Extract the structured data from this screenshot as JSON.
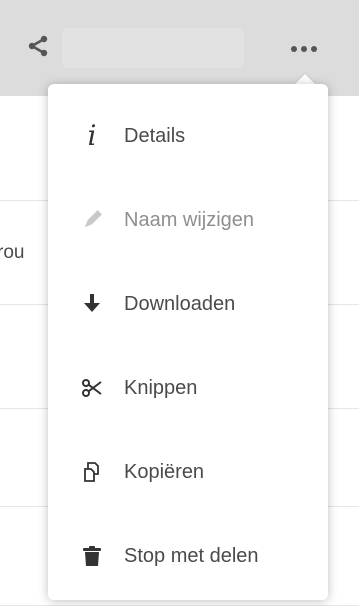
{
  "header": {
    "share_icon": "share-icon",
    "more_icon": "more-horizontal-icon"
  },
  "background": {
    "partial_text": "rou"
  },
  "menu": {
    "items": [
      {
        "label": "Details",
        "icon": "info-icon"
      },
      {
        "label": "Naam wijzigen",
        "icon": "pencil-icon"
      },
      {
        "label": "Downloaden",
        "icon": "download-icon"
      },
      {
        "label": "Knippen",
        "icon": "scissors-icon"
      },
      {
        "label": "Kopiëren",
        "icon": "copy-icon"
      },
      {
        "label": "Stop met delen",
        "icon": "trash-icon"
      }
    ]
  }
}
